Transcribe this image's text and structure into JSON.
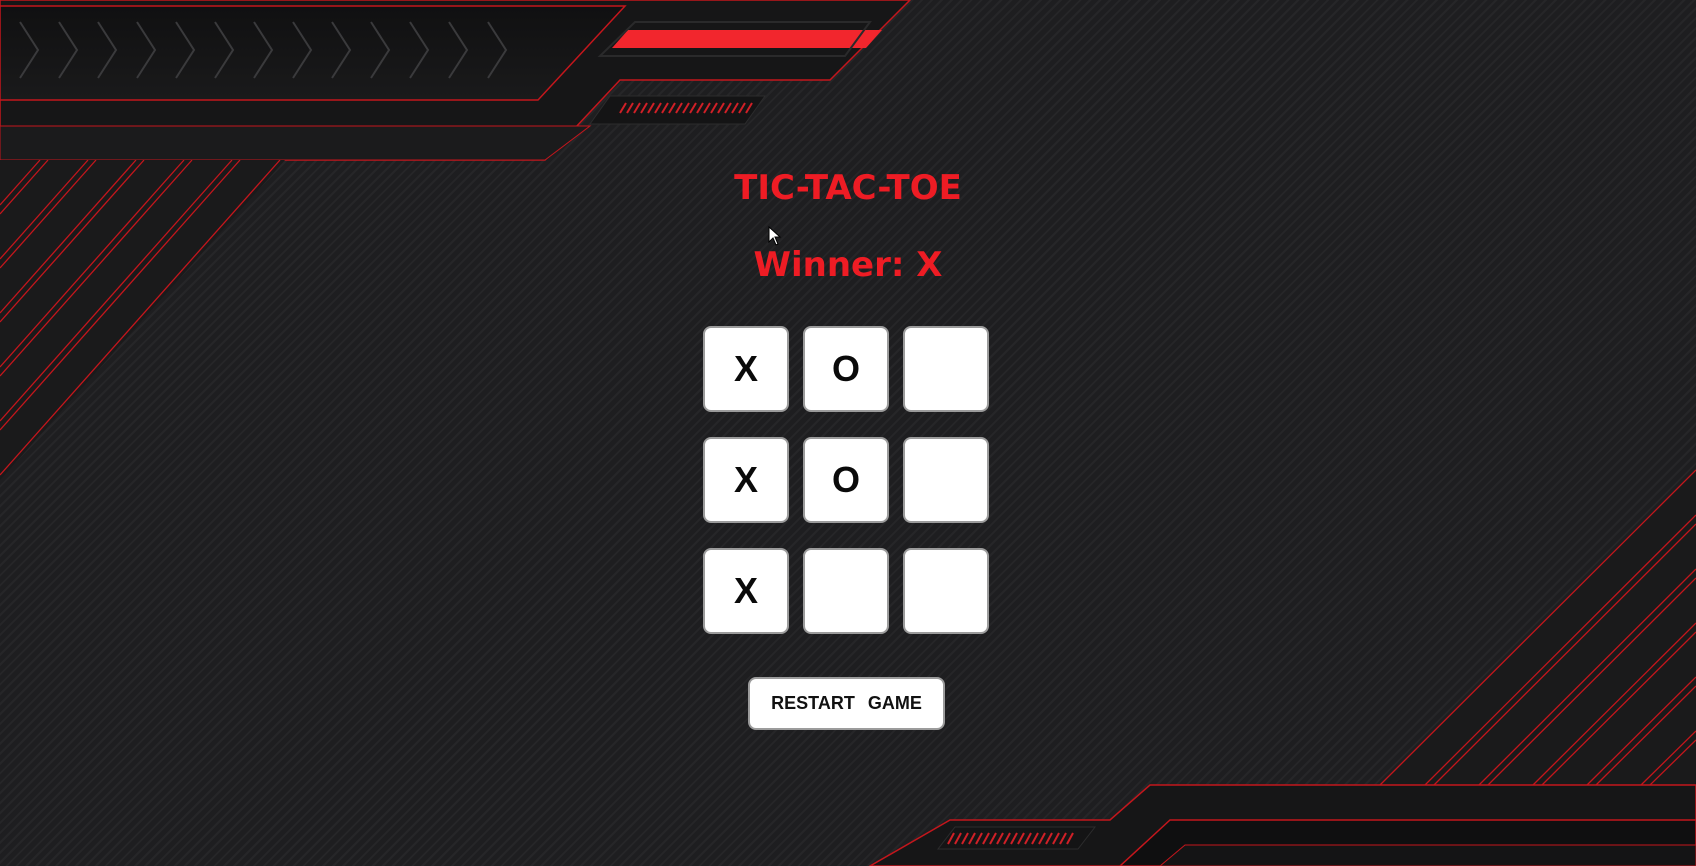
{
  "game": {
    "title": "TIC-TAC-TOE",
    "status": "Winner: X",
    "board": [
      [
        "X",
        "O",
        ""
      ],
      [
        "X",
        "O",
        ""
      ],
      [
        "X",
        "",
        ""
      ]
    ],
    "restart_label": "RESTART GAME"
  },
  "colors": {
    "accent": "#ee1c24",
    "background": "#1e1e20",
    "cell_background": "#ffffff",
    "mark": "#0a0a0a"
  },
  "icons": {
    "cursor": "mouse-pointer-icon"
  }
}
